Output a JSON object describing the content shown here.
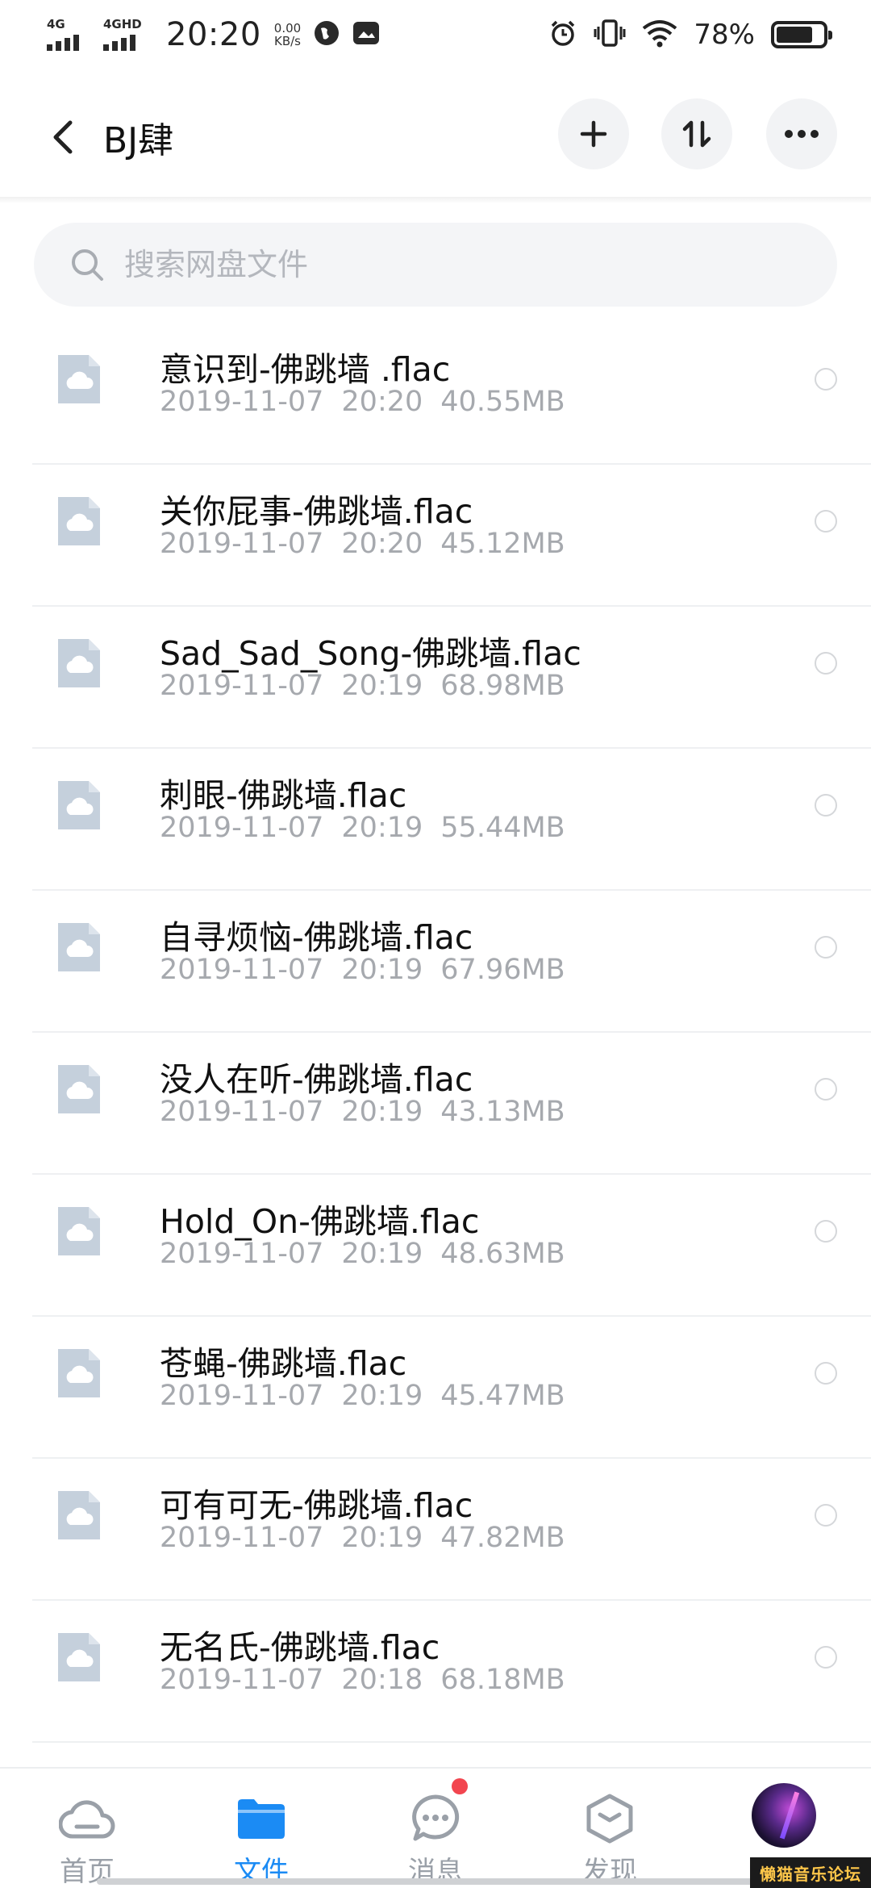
{
  "status_bar": {
    "network_1": "4G",
    "network_2": "4GHD",
    "time": "20:20",
    "speed_value": "0.00",
    "speed_unit": "KB/s",
    "battery_percent": "78%",
    "battery_level": 0.78,
    "icons": [
      "browser-globe-icon",
      "gallery-icon",
      "alarm-icon",
      "vibrate-icon",
      "wifi-icon",
      "battery-icon"
    ]
  },
  "header": {
    "title": "BJ肆",
    "icons": [
      "back-chevron-icon",
      "plus-icon",
      "sort-icon",
      "more-icon"
    ]
  },
  "search": {
    "placeholder": "搜索网盘文件",
    "value": ""
  },
  "files": [
    {
      "name": "意识到-佛跳墙 .flac",
      "date": "2019-11-07",
      "time": "20:20",
      "size": "40.55MB"
    },
    {
      "name": "关你屁事-佛跳墙.flac",
      "date": "2019-11-07",
      "time": "20:20",
      "size": "45.12MB"
    },
    {
      "name": "Sad_Sad_Song-佛跳墙.flac",
      "date": "2019-11-07",
      "time": "20:19",
      "size": "68.98MB"
    },
    {
      "name": "刺眼-佛跳墙.flac",
      "date": "2019-11-07",
      "time": "20:19",
      "size": "55.44MB"
    },
    {
      "name": "自寻烦恼-佛跳墙.flac",
      "date": "2019-11-07",
      "time": "20:19",
      "size": "67.96MB"
    },
    {
      "name": "没人在听-佛跳墙.flac",
      "date": "2019-11-07",
      "time": "20:19",
      "size": "43.13MB"
    },
    {
      "name": "Hold_On-佛跳墙.flac",
      "date": "2019-11-07",
      "time": "20:19",
      "size": "48.63MB"
    },
    {
      "name": "苍蝇-佛跳墙.flac",
      "date": "2019-11-07",
      "time": "20:19",
      "size": "45.47MB"
    },
    {
      "name": "可有可无-佛跳墙.flac",
      "date": "2019-11-07",
      "time": "20:19",
      "size": "47.82MB"
    },
    {
      "name": "无名氏-佛跳墙.flac",
      "date": "2019-11-07",
      "time": "20:18",
      "size": "68.18MB"
    }
  ],
  "tabs": [
    {
      "label": "首页",
      "icon": "cloud-home-icon",
      "active": false
    },
    {
      "label": "文件",
      "icon": "folder-icon",
      "active": true
    },
    {
      "label": "消息",
      "icon": "chat-icon",
      "active": false,
      "badge": true
    },
    {
      "label": "发现",
      "icon": "discover-cube-icon",
      "active": false
    },
    {
      "label": "",
      "icon": "avatar",
      "active": false
    }
  ],
  "watermark": "懒猫音乐论坛",
  "colors": {
    "accent": "#1b8bf4",
    "badge": "#f2454f",
    "file_icon": "#c5d0dc",
    "meta_text": "#a6a9ae",
    "search_bg": "#f4f5f7"
  }
}
